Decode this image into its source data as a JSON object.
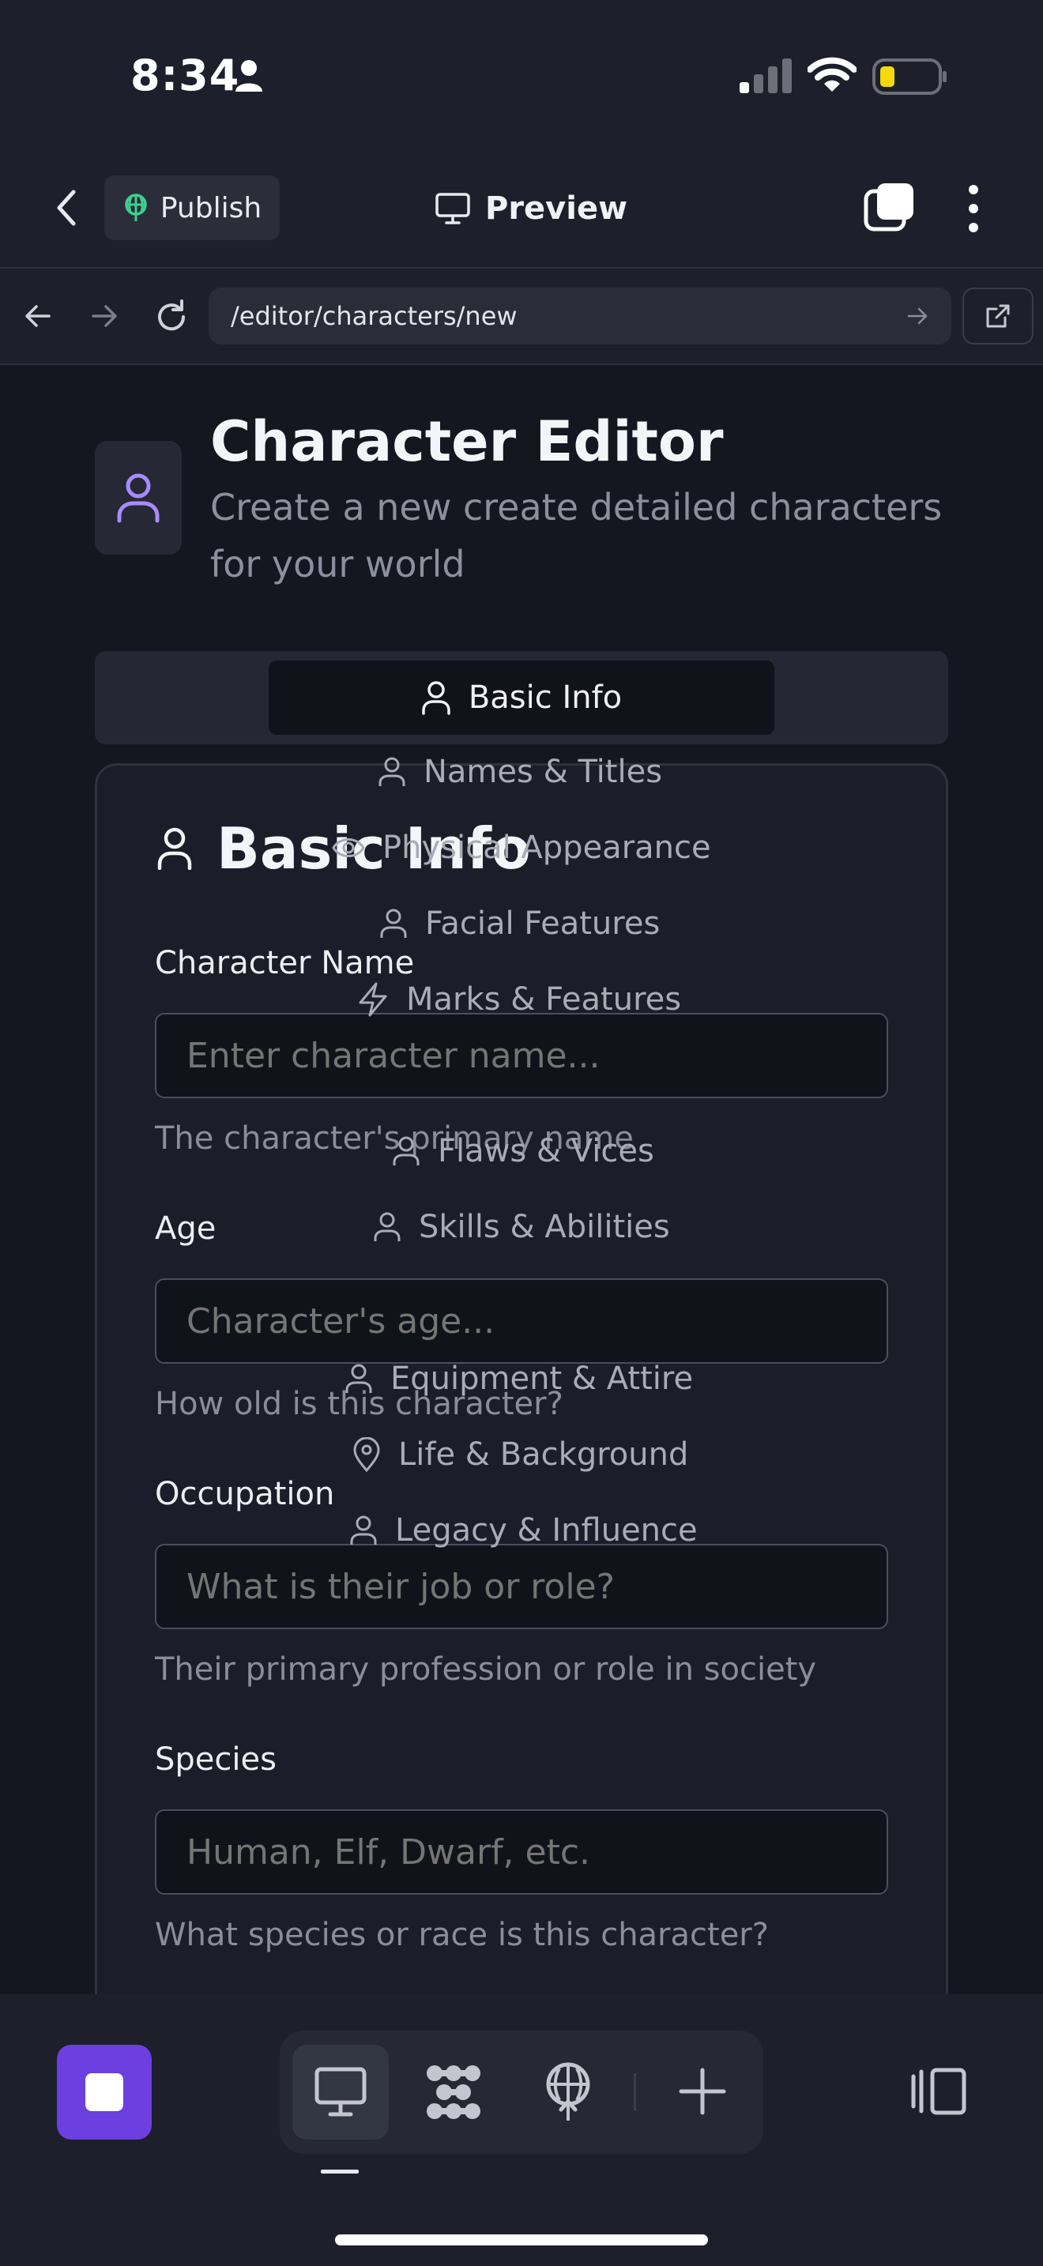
{
  "status_bar": {
    "time": "8:34"
  },
  "header": {
    "publish_label": "Publish",
    "preview_label": "Preview"
  },
  "browser": {
    "url": "/editor/characters/new"
  },
  "page": {
    "title": "Character Editor",
    "subtitle": "Create a new create detailed characters for your world"
  },
  "tabs": {
    "active_label": "Basic Info"
  },
  "dropdown_items": [
    {
      "label": "Names & Titles",
      "icon": "user-icon"
    },
    {
      "label": "Physical Appearance",
      "icon": "eye-icon"
    },
    {
      "label": "Facial Features",
      "icon": "user-icon"
    },
    {
      "label": "Marks & Features",
      "icon": "lightning-icon"
    },
    {
      "label": "Flaws & Vices",
      "icon": "user-icon"
    },
    {
      "label": "Skills & Abilities",
      "icon": "user-icon"
    },
    {
      "label": "Equipment & Attire",
      "icon": "user-icon"
    },
    {
      "label": "Life & Background",
      "icon": "map-pin-icon"
    },
    {
      "label": "Legacy & Influence",
      "icon": "user-icon"
    }
  ],
  "card": {
    "title": "Basic Info",
    "fields": [
      {
        "label": "Character Name",
        "placeholder": "Enter character name...",
        "help": "The character's primary name"
      },
      {
        "label": "Age",
        "placeholder": "Character's age...",
        "help": "How old is this character?"
      },
      {
        "label": "Occupation",
        "placeholder": "What is their job or role?",
        "help": "Their primary profession or role in society"
      },
      {
        "label": "Species",
        "placeholder": "Human, Elf, Dwarf, etc.",
        "help": "What species or race is this character?"
      }
    ]
  },
  "colors": {
    "accent": "#6b3fe0",
    "publish_icon": "#3ecf8e",
    "avatar_icon": "#a78bfa",
    "battery": "#f5d90a"
  }
}
